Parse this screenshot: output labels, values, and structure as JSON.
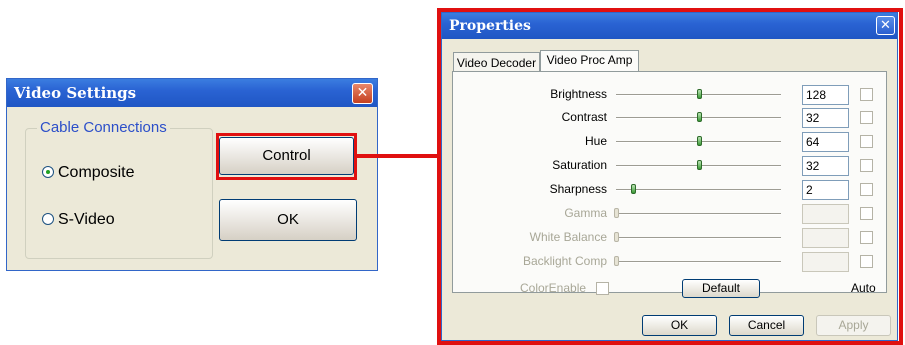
{
  "video_settings": {
    "title": "Video Settings",
    "close_label": "✕",
    "group_label": "Cable Connections",
    "options": [
      {
        "label": "Composite",
        "selected": true
      },
      {
        "label": "S-Video",
        "selected": false
      }
    ],
    "control_button": "Control",
    "ok_button": "OK"
  },
  "properties": {
    "title": "Properties",
    "close_label": "✕",
    "tabs": [
      {
        "label": "Video Decoder",
        "active": false
      },
      {
        "label": "Video Proc Amp",
        "active": true
      }
    ],
    "settings": [
      {
        "label": "Brightness",
        "value": "128",
        "enabled": true,
        "level": 0.5
      },
      {
        "label": "Contrast",
        "value": "32",
        "enabled": true,
        "level": 0.5
      },
      {
        "label": "Hue",
        "value": "64",
        "enabled": true,
        "level": 0.5
      },
      {
        "label": "Saturation",
        "value": "32",
        "enabled": true,
        "level": 0.5
      },
      {
        "label": "Sharpness",
        "value": "2",
        "enabled": true,
        "level": 0.1
      },
      {
        "label": "Gamma",
        "value": "",
        "enabled": false,
        "level": 0
      },
      {
        "label": "White Balance",
        "value": "",
        "enabled": false,
        "level": 0
      },
      {
        "label": "Backlight Comp",
        "value": "",
        "enabled": false,
        "level": 0
      }
    ],
    "color_enable_label": "ColorEnable",
    "default_button": "Default",
    "auto_label": "Auto",
    "ok_button": "OK",
    "cancel_button": "Cancel",
    "apply_button": "Apply"
  },
  "colors": {
    "highlight": "#e01010",
    "titlebar": "#2a63d3",
    "slider_thumb": "#3a9a36"
  }
}
